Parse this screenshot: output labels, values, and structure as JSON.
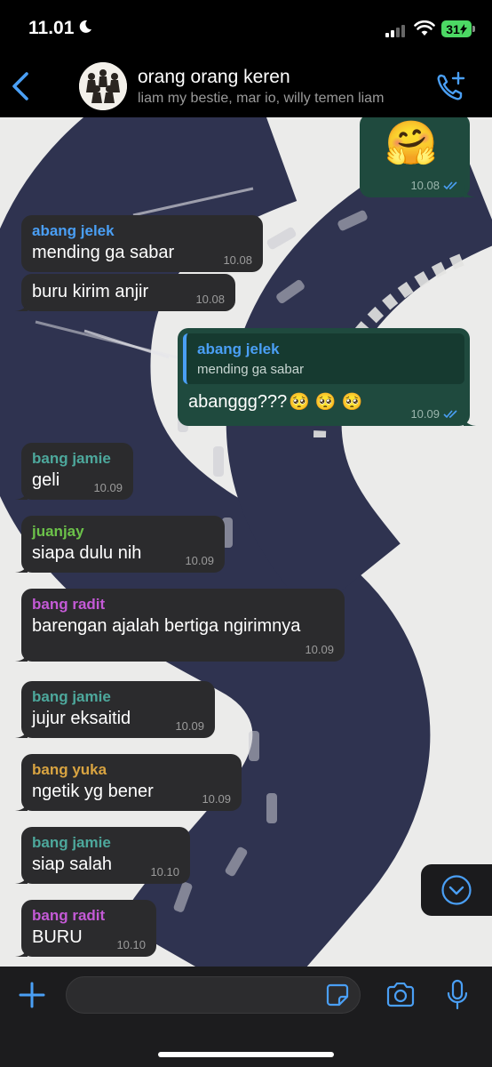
{
  "status_bar": {
    "time": "11.01",
    "battery": "31"
  },
  "header": {
    "title": "orang orang keren",
    "subtitle": "liam my bestie, mar io, willy temen liam"
  },
  "colors": {
    "accent_blue": "#4a9ff5",
    "incoming_bubble": "#2b2b2d",
    "outgoing_bubble": "#1f4a3e",
    "name_abang_jelek": "#4a9ff5",
    "name_bang_jamie": "#4da89c",
    "name_juanjay": "#6cc24a",
    "name_bang_radit": "#c45ad6",
    "name_bang_yuka": "#d9a441"
  },
  "messages": [
    {
      "direction": "out",
      "emoji": "🤗",
      "time": "10.08",
      "status": "read"
    },
    {
      "direction": "in",
      "sender": "abang jelek",
      "text": "mending ga sabar",
      "time": "10.08"
    },
    {
      "direction": "in",
      "text": "buru kirim anjir",
      "time": "10.08"
    },
    {
      "direction": "out",
      "quote_sender": "abang jelek",
      "quote_text": "mending ga sabar",
      "text": "abanggg???",
      "reaction_emoji": "🥺",
      "time": "10.09",
      "status": "read"
    },
    {
      "direction": "in",
      "sender": "bang jamie",
      "text": "geli",
      "time": "10.09"
    },
    {
      "direction": "in",
      "sender": "juanjay",
      "text": "siapa dulu nih",
      "time": "10.09"
    },
    {
      "direction": "in",
      "sender": "bang radit",
      "text": "barengan ajalah bertiga ngirimnya",
      "time": "10.09"
    },
    {
      "direction": "in",
      "sender": "bang jamie",
      "text": "jujur eksaitid",
      "time": "10.09"
    },
    {
      "direction": "in",
      "sender": "bang yuka",
      "text": "ngetik yg bener",
      "time": "10.09"
    },
    {
      "direction": "in",
      "sender": "bang jamie",
      "text": "siap salah",
      "time": "10.10"
    },
    {
      "direction": "in",
      "sender": "bang radit",
      "text": "BURU",
      "time": "10.10"
    }
  ],
  "icons": {
    "back": "back-chevron-icon",
    "add_call": "add-call-icon",
    "scroll_down": "chevron-down-circle-icon",
    "attach": "plus-icon",
    "sticker": "sticker-icon",
    "camera": "camera-icon",
    "voice": "microphone-icon"
  }
}
